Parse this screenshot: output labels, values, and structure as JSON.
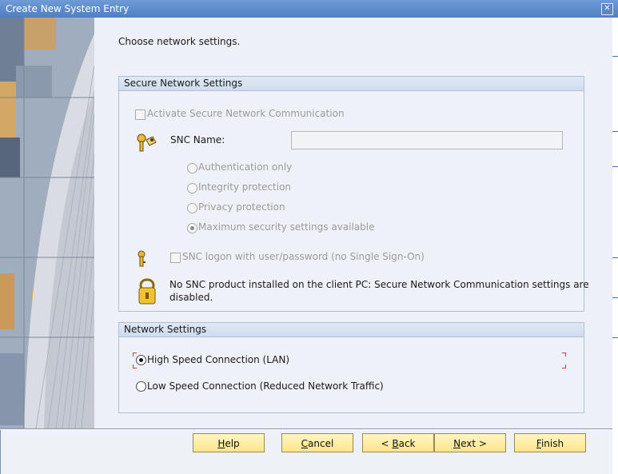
{
  "window": {
    "title": "Create New System Entry",
    "close_glyph": "✕"
  },
  "intro": "Choose network settings.",
  "secure": {
    "header": "Secure Network Settings",
    "activate_label": "Activate Secure Network Communication",
    "snc_name_label": "SNC Name:",
    "snc_name_value": "",
    "options": [
      {
        "label": "Authentication only",
        "selected": false
      },
      {
        "label": "Integrity protection",
        "selected": false
      },
      {
        "label": "Privacy protection",
        "selected": false
      },
      {
        "label": "Maximum security settings available",
        "selected": true
      }
    ],
    "snc_logon_label": "SNC logon with user/password (no Single Sign-On)",
    "info_line1": "No SNC product installed on the client PC: Secure Network Communication settings are",
    "info_line2": "disabled."
  },
  "network": {
    "header": "Network Settings",
    "options": [
      {
        "label": "High Speed Connection (LAN)",
        "selected": true
      },
      {
        "label": "Low Speed Connection (Reduced Network Traffic)",
        "selected": false
      }
    ]
  },
  "buttons": {
    "help": {
      "accel": "H",
      "rest": "elp"
    },
    "cancel": {
      "accel": "C",
      "rest": "ancel"
    },
    "back": {
      "pre": "< ",
      "accel": "B",
      "rest": "ack"
    },
    "next": {
      "accel": "N",
      "rest": "ext >"
    },
    "finish": {
      "accel": "F",
      "rest": "inish"
    }
  },
  "icons": {
    "key": "key-icon",
    "lock": "lock-icon",
    "key_person": "key-person-icon"
  },
  "colors": {
    "button_fill": "#ffe58a",
    "title_bar": "#4f7fc3",
    "focus_marker": "#e03a2a"
  }
}
